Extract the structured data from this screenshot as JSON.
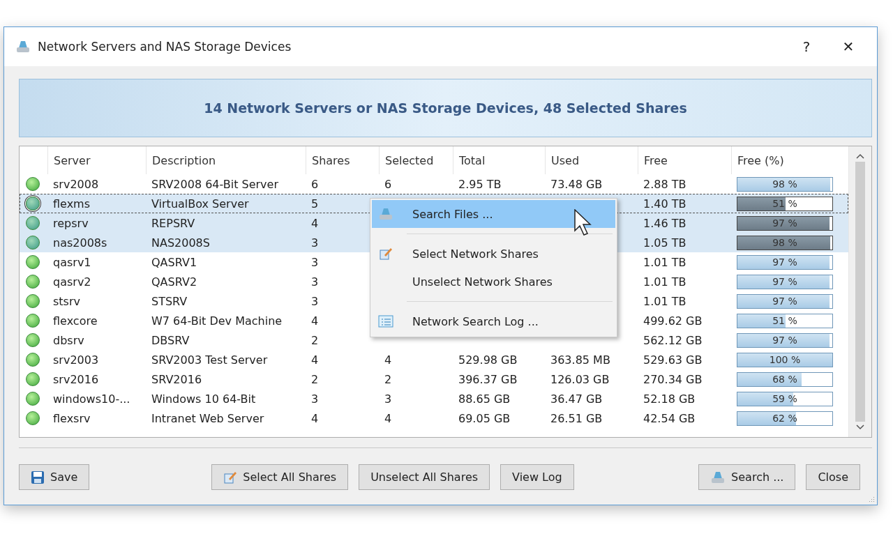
{
  "window": {
    "title": "Network Servers and NAS Storage Devices",
    "help": "?",
    "close": "✕"
  },
  "banner": "14 Network Servers or NAS Storage Devices, 48 Selected Shares",
  "table": {
    "columns": [
      "Server",
      "Description",
      "Shares",
      "Selected",
      "Total",
      "Used",
      "Free",
      "Free (%)"
    ],
    "rows": [
      {
        "server": "srv2008",
        "description": "SRV2008 64-Bit Server",
        "shares": "6",
        "selected_count": "6",
        "total": "2.95 TB",
        "used": "73.48 GB",
        "free": "2.88 TB",
        "free_pct": "98 %",
        "level": 0.98,
        "selected": false,
        "focused": false
      },
      {
        "server": "flexms",
        "description": "VirtualBox Server",
        "shares": "5",
        "free": "1.40 TB",
        "free_pct": "51 %",
        "level": 0.51,
        "selected": true,
        "focused": true
      },
      {
        "server": "repsrv",
        "description": "REPSRV",
        "shares": "4",
        "free": "1.46 TB",
        "free_pct": "97 %",
        "level": 0.97,
        "selected": true,
        "focused": false
      },
      {
        "server": "nas2008s",
        "description": "NAS2008S",
        "shares": "3",
        "free": "1.05 TB",
        "free_pct": "98 %",
        "level": 0.98,
        "selected": true,
        "focused": false
      },
      {
        "server": "qasrv1",
        "description": "QASRV1",
        "shares": "3",
        "free": "1.01 TB",
        "free_pct": "97 %",
        "level": 0.97,
        "selected": false,
        "focused": false
      },
      {
        "server": "qasrv2",
        "description": "QASRV2",
        "shares": "3",
        "free": "1.01 TB",
        "free_pct": "97 %",
        "level": 0.97,
        "selected": false,
        "focused": false
      },
      {
        "server": "stsrv",
        "description": "STSRV",
        "shares": "3",
        "free": "1.01 TB",
        "free_pct": "97 %",
        "level": 0.97,
        "selected": false,
        "focused": false
      },
      {
        "server": "flexcore",
        "description": "W7 64-Bit Dev Machine",
        "shares": "4",
        "free": "499.62 GB",
        "free_pct": "51 %",
        "level": 0.51,
        "selected": false,
        "focused": false
      },
      {
        "server": "dbsrv",
        "description": "DBSRV",
        "shares": "2",
        "free": "562.12 GB",
        "free_pct": "97 %",
        "level": 0.97,
        "selected": false,
        "focused": false
      },
      {
        "server": "srv2003",
        "description": "SRV2003 Test Server",
        "shares": "4",
        "selected_count": "4",
        "total": "529.98 GB",
        "used": "363.85 MB",
        "free": "529.63 GB",
        "free_pct": "100 %",
        "level": 1.0,
        "selected": false,
        "focused": false
      },
      {
        "server": "srv2016",
        "description": "SRV2016",
        "shares": "2",
        "selected_count": "2",
        "total": "396.37 GB",
        "used": "126.03 GB",
        "free": "270.34 GB",
        "free_pct": "68 %",
        "level": 0.68,
        "selected": false,
        "focused": false
      },
      {
        "server": "windows10-...",
        "description": "Windows 10 64-Bit",
        "shares": "3",
        "selected_count": "3",
        "total": "88.65 GB",
        "used": "36.47 GB",
        "free": "52.18 GB",
        "free_pct": "59 %",
        "level": 0.59,
        "selected": false,
        "focused": false
      },
      {
        "server": "flexsrv",
        "description": "Intranet Web Server",
        "shares": "4",
        "selected_count": "4",
        "total": "69.05 GB",
        "used": "26.51 GB",
        "free": "42.54 GB",
        "free_pct": "62 %",
        "level": 0.62,
        "selected": false,
        "focused": false
      }
    ]
  },
  "context_menu": {
    "items": [
      {
        "kind": "item",
        "label": "Search Files ...",
        "selected": true
      },
      {
        "kind": "separator"
      },
      {
        "kind": "item",
        "label": "Select Network Shares",
        "selected": false
      },
      {
        "kind": "item",
        "label": "Unselect Network Shares",
        "selected": false
      },
      {
        "kind": "separator"
      },
      {
        "kind": "item",
        "label": "Network Search Log ...",
        "selected": false
      }
    ]
  },
  "buttons": [
    "Save",
    "Select All Shares",
    "Unselect All Shares",
    "View Log",
    "Search ...",
    "Close"
  ]
}
